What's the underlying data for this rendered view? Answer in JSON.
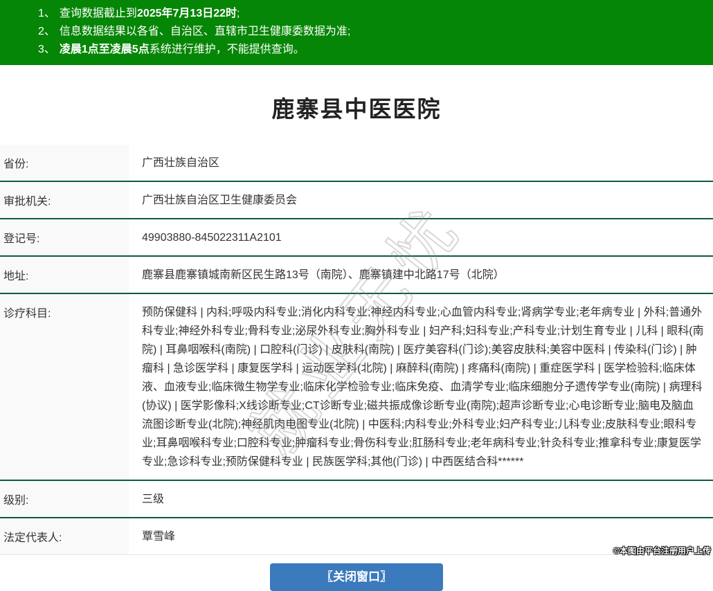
{
  "notice": {
    "items": [
      {
        "num": "1、",
        "pre": "查询数据截止到",
        "bold": "2025年7月13日22时",
        "post": ";"
      },
      {
        "num": "2、",
        "pre": "信息数据结果以各省、自治区、直辖市卫生健康委数据为准;",
        "bold": "",
        "post": ""
      },
      {
        "num": "3、",
        "pre": "",
        "bold": "凌晨1点至凌晨5点",
        "post": "系统进行维护，不能提供查询。"
      }
    ]
  },
  "title": "鹿寨县中医医院",
  "table": {
    "rows": [
      {
        "label": "省份:",
        "value": "广西壮族自治区"
      },
      {
        "label": "审批机关:",
        "value": "广西壮族自治区卫生健康委员会"
      },
      {
        "label": "登记号:",
        "value": "49903880-845022311A2101"
      },
      {
        "label": "地址:",
        "value": "鹿寨县鹿寨镇城南新区民生路13号（南院）、鹿寨镇建中北路17号（北院）"
      },
      {
        "label": "诊疗科目:",
        "value": "预防保健科 | 内科;呼吸内科专业;消化内科专业;神经内科专业;心血管内科专业;肾病学专业;老年病专业 | 外科;普通外科专业;神经外科专业;骨科专业;泌尿外科专业;胸外科专业 | 妇产科;妇科专业;产科专业;计划生育专业 | 儿科 | 眼科(南院) | 耳鼻咽喉科(南院) | 口腔科(门诊) | 皮肤科(南院) | 医疗美容科(门诊);美容皮肤科;美容中医科 | 传染科(门诊) | 肿瘤科 | 急诊医学科 | 康复医学科 | 运动医学科(北院) | 麻醉科(南院) | 疼痛科(南院) | 重症医学科 | 医学检验科;临床体液、血液专业;临床微生物学专业;临床化学检验专业;临床免疫、血清学专业;临床细胞分子遗传学专业(南院) | 病理科(协议) | 医学影像科;X线诊断专业;CT诊断专业;磁共振成像诊断专业(南院);超声诊断专业;心电诊断专业;脑电及脑血流图诊断专业(北院);神经肌肉电图专业(北院) | 中医科;内科专业;外科专业;妇产科专业;儿科专业;皮肤科专业;眼科专业;耳鼻咽喉科专业;口腔科专业;肿瘤科专业;骨伤科专业;肛肠科专业;老年病科专业;针灸科专业;推拿科专业;康复医学专业;急诊科专业;预防保健科专业 | 民族医学科;其他(门诊) | 中西医结合科******"
      },
      {
        "label": "级别:",
        "value": "三级"
      },
      {
        "label": "法定代表人:",
        "value": "覃雪峰"
      }
    ]
  },
  "close_button_label": "〖关闭窗口〗",
  "watermark_text": "就业无忧",
  "attribution": "©本图由平台注册用户上传",
  "colors": {
    "banner_green": "#068606",
    "divider_green": "#0d5c3a",
    "label_bg": "#f9f9f9",
    "button_blue": "#3a7abd",
    "text": "#333333"
  }
}
